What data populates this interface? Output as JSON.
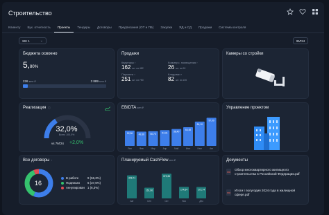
{
  "app": {
    "title": "Строительство"
  },
  "tabs": [
    {
      "label": "Клиенту"
    },
    {
      "label": "Бух. отчетность"
    },
    {
      "label": "Проекты"
    },
    {
      "label": "Тендеры"
    },
    {
      "label": "Договоры"
    },
    {
      "label": "Предписания (ОТ и ПБ)"
    },
    {
      "label": "Закупки"
    },
    {
      "label": "ЯД и СД"
    },
    {
      "label": "Продажи"
    },
    {
      "label": "Система контроля"
    }
  ],
  "filters": {
    "complex": "ЖК 1",
    "period": "9М'24"
  },
  "budget": {
    "title": "Бюджета освоено",
    "value": "5,",
    "value_small": "80%",
    "spent": "226",
    "spent_unit": "млн ₽",
    "total": "3 889",
    "total_unit": "млн ₽",
    "progress": 0.058
  },
  "sales": {
    "title": "Продажи",
    "items": [
      {
        "name": "Квартиры",
        "value": "162",
        "unit": "шт. из 482"
      },
      {
        "name": "Коммерч. помещения",
        "value": "26",
        "unit": "шт. из 90"
      },
      {
        "name": "Паркинги",
        "value": "251",
        "unit": "шт. из 750"
      },
      {
        "name": "Кладовки",
        "value": "82",
        "unit": "шт. из 100"
      }
    ]
  },
  "cameras": {
    "title": "Камеры со стройки"
  },
  "realization": {
    "title": "Реализация",
    "value": "32,0%",
    "subtext": "Всего 100,0%",
    "vs_label": "vs 7M'24",
    "delta": "+2,0%",
    "fraction": 0.32
  },
  "ebitda": {
    "title": "EBIDTA",
    "unit": "млн ₽"
  },
  "management": {
    "title": "Управление проектом"
  },
  "contracts": {
    "title": "Все договоры",
    "total": "16",
    "items": [
      {
        "name": "В работе",
        "value": "9 (56,3%)",
        "color": "#3d7eea"
      },
      {
        "name": "Подписан",
        "value": "6 (37,5%)",
        "color": "#35c26e"
      },
      {
        "name": "Аннулирован",
        "value": "1 (6,3%)",
        "color": "#e24b55"
      }
    ]
  },
  "cashflow": {
    "title": "Планируемый CashFlow",
    "unit": "млн ₽"
  },
  "documents": {
    "title": "Документы",
    "pdf_label": "PDF",
    "items": [
      {
        "name": "Обзор многоквартирного жилищного строительства в Российской Федерации.pdf"
      },
      {
        "name": "Итоги I полугодия 2024 года в жилищной сфере.pdf"
      }
    ]
  },
  "chart_data": [
    {
      "type": "bar",
      "title": "EBIDTA",
      "unit": "млн ₽",
      "categories": [
        "Янв",
        "Фев",
        "Мар",
        "Апр",
        "Май",
        "Июн",
        "Июл",
        "Авг"
      ],
      "values": [
        52.96,
        49.36,
        50.7,
        54.31,
        58.4,
        64.48,
        84.1,
        97.0
      ],
      "value_labels": [
        "52,96",
        "49,36",
        "50,70",
        "54,31",
        "58,40",
        "64,48",
        "84,10",
        "97,00"
      ],
      "color": "#3d7eea"
    },
    {
      "type": "bar",
      "title": "Планируемый CashFlow",
      "unit": "млн ₽",
      "categories": [
        "Авг",
        "Сен",
        "Окт",
        "Ноя",
        "Дек"
      ],
      "values": [
        348.71,
        161.96,
        373.36,
        174.64,
        172.74
      ],
      "value_labels": [
        "348,71",
        "161,96",
        "373,36",
        "174,64",
        "172,74"
      ],
      "color": "#1f7a78"
    }
  ]
}
